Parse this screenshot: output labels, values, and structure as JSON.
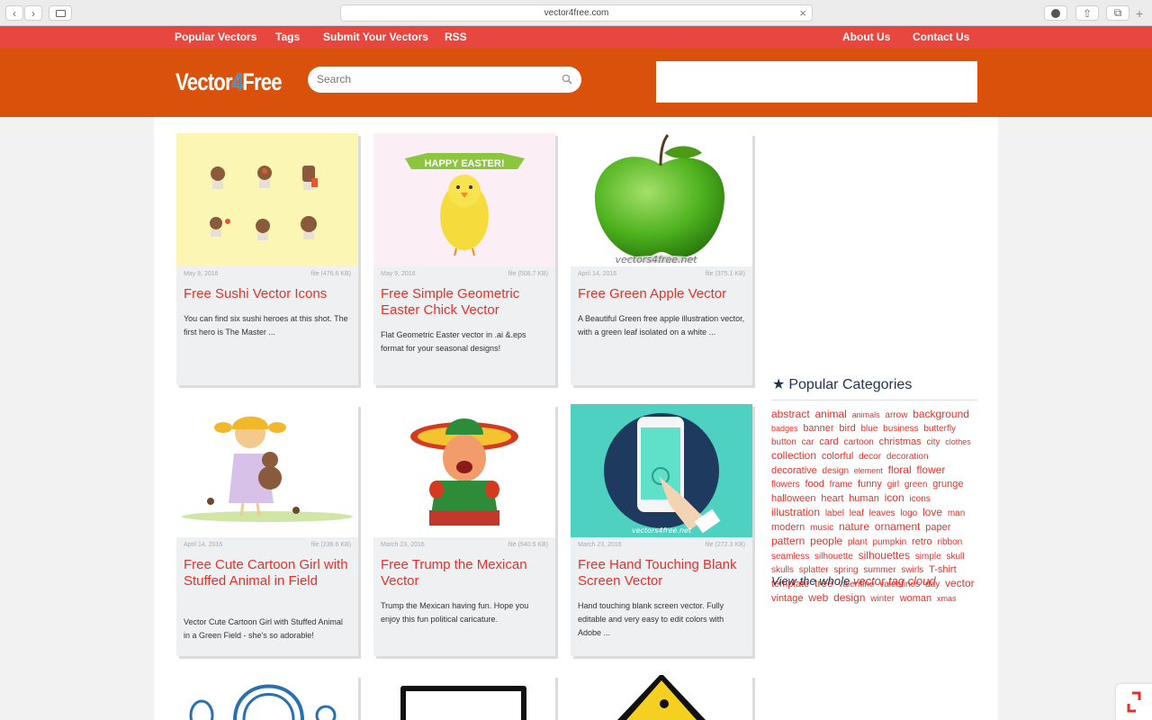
{
  "browser": {
    "url": "vector4free.com"
  },
  "topnav": {
    "left": [
      "Popular Vectors",
      "Tags",
      "Submit Your Vectors",
      "RSS"
    ],
    "right": [
      "About Us",
      "Contact Us"
    ]
  },
  "header": {
    "logo_a": "Vector",
    "logo_b": "4",
    "logo_c": "Free",
    "search_placeholder": "Search"
  },
  "colors": {
    "topnav": "#e8473f",
    "header": "#d9510a",
    "title": "#e8302a"
  },
  "cards": [
    {
      "date": "May 9, 2016",
      "size": "file (476.6 KB)",
      "title": "Free Sushi Vector Icons",
      "desc": "You can find six sushi heroes at this shot. The first hero is The Master ..."
    },
    {
      "date": "May 9, 2016",
      "size": "file (506.7 KB)",
      "title": "Free Simple Geometric Easter Chick Vector",
      "desc": "Flat Geometric Easter vector in .ai &.eps format for your seasonal designs!",
      "banner": "HAPPY EASTER!"
    },
    {
      "date": "April 14, 2016",
      "size": "file (375.1 KB)",
      "title": "Free Green Apple Vector",
      "desc": "A Beautiful Green free apple illustration vector, with a green leaf isolated on a white ...",
      "watermark": "vectors4free.net"
    },
    {
      "date": "April 14, 2016",
      "size": "file (236.6 KB)",
      "title": "Free Cute Cartoon Girl with Stuffed Animal in Field",
      "desc": "Vector Cute Cartoon Girl with Stuffed Animal in a Green Field - she's so adorable!"
    },
    {
      "date": "March 23, 2016",
      "size": "file (540.5 KB)",
      "title": "Free Trump the Mexican Vector",
      "desc": "Trump the Mexican having fun. Hope you enjoy this fun political caricature."
    },
    {
      "date": "March 23, 2016",
      "size": "file (272.3 KB)",
      "title": "Free Hand Touching Blank Screen Vector",
      "desc": "Hand touching blank screen vector. Fully editable and very easy to edit colors with Adobe ...",
      "watermark": "vectors4free.net"
    }
  ],
  "sidebar": {
    "title": "Popular Categories",
    "view_prefix": "View the whole ",
    "view_link": "vector tag cloud"
  },
  "tags": [
    [
      "abstract",
      12
    ],
    [
      "animal",
      12
    ],
    [
      "animals",
      9
    ],
    [
      "arrow",
      10
    ],
    [
      "background",
      12
    ],
    [
      "badges",
      9
    ],
    [
      "banner",
      11
    ],
    [
      "bird",
      11
    ],
    [
      "blue",
      10
    ],
    [
      "business",
      10
    ],
    [
      "butterfly",
      10
    ],
    [
      "button",
      10
    ],
    [
      "car",
      10
    ],
    [
      "card",
      11
    ],
    [
      "cartoon",
      10
    ],
    [
      "christmas",
      11
    ],
    [
      "city",
      10
    ],
    [
      "clothes",
      9
    ],
    [
      "collection",
      12
    ],
    [
      "colorful",
      11
    ],
    [
      "decor",
      10
    ],
    [
      "decoration",
      10
    ],
    [
      "decorative",
      11
    ],
    [
      "design",
      10
    ],
    [
      "element",
      9
    ],
    [
      "floral",
      12
    ],
    [
      "flower",
      12
    ],
    [
      "flowers",
      10
    ],
    [
      "food",
      11
    ],
    [
      "frame",
      10
    ],
    [
      "funny",
      11
    ],
    [
      "girl",
      10
    ],
    [
      "green",
      10
    ],
    [
      "grunge",
      11
    ],
    [
      "halloween",
      11
    ],
    [
      "heart",
      11
    ],
    [
      "human",
      11
    ],
    [
      "icon",
      12
    ],
    [
      "icons",
      10
    ],
    [
      "illustration",
      12
    ],
    [
      "label",
      10
    ],
    [
      "leaf",
      10
    ],
    [
      "leaves",
      10
    ],
    [
      "logo",
      10
    ],
    [
      "love",
      12
    ],
    [
      "man",
      10
    ],
    [
      "modern",
      11
    ],
    [
      "music",
      10
    ],
    [
      "nature",
      12
    ],
    [
      "ornament",
      12
    ],
    [
      "paper",
      11
    ],
    [
      "pattern",
      12
    ],
    [
      "people",
      12
    ],
    [
      "plant",
      10
    ],
    [
      "pumpkin",
      10
    ],
    [
      "retro",
      11
    ],
    [
      "ribbon",
      10
    ],
    [
      "seamless",
      10
    ],
    [
      "silhouette",
      10
    ],
    [
      "silhouettes",
      12
    ],
    [
      "simple",
      10
    ],
    [
      "skull",
      10
    ],
    [
      "skulls",
      10
    ],
    [
      "splatter",
      10
    ],
    [
      "spring",
      10
    ],
    [
      "summer",
      10
    ],
    [
      "swirls",
      10
    ],
    [
      "T-shirt",
      11
    ],
    [
      "template",
      11
    ],
    [
      "tree",
      12
    ],
    [
      "valentine",
      10
    ],
    [
      "valentines",
      10
    ],
    [
      "day",
      10
    ],
    [
      "vector",
      12
    ],
    [
      "vintage",
      11
    ],
    [
      "web",
      12
    ],
    [
      "design",
      12
    ],
    [
      "winter",
      10
    ],
    [
      "woman",
      11
    ],
    [
      "xmas",
      9
    ]
  ]
}
